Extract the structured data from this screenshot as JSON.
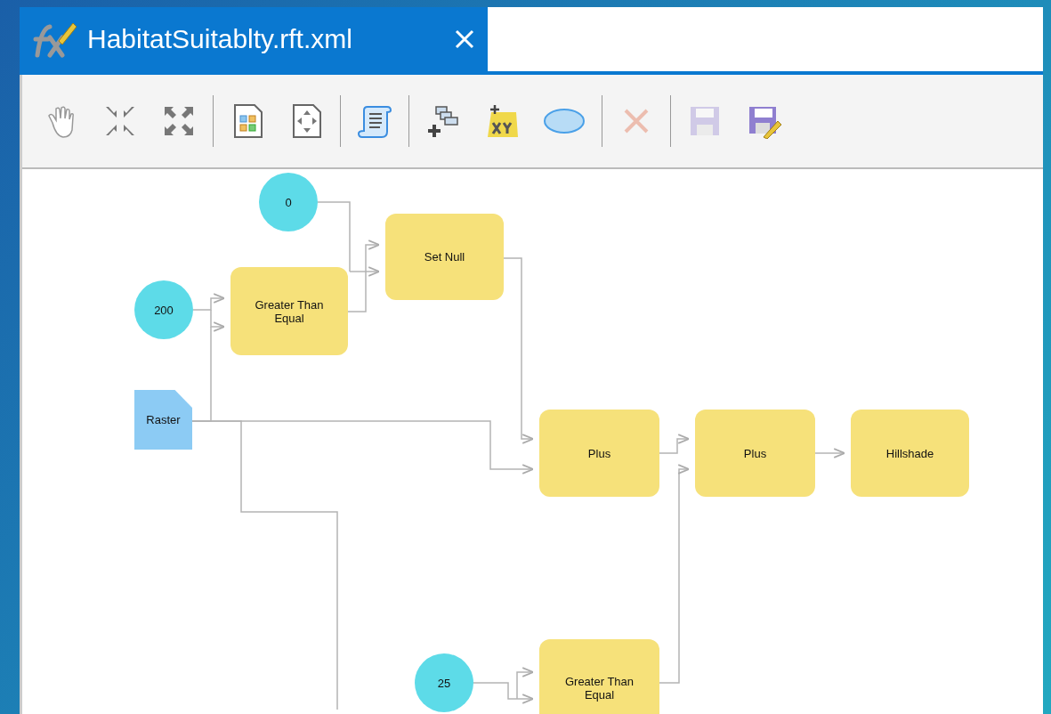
{
  "tab": {
    "title": "HabitatSuitablty.rft.xml",
    "selected": true
  },
  "toolbar_groups": [
    [
      {
        "kind": "pan",
        "disabled": false
      },
      {
        "kind": "collapse",
        "disabled": false
      },
      {
        "kind": "expand",
        "disabled": false
      }
    ],
    [
      {
        "kind": "auto-layout",
        "disabled": false
      },
      {
        "kind": "fit",
        "disabled": false
      }
    ],
    [
      {
        "kind": "script",
        "disabled": false
      }
    ],
    [
      {
        "kind": "add-function",
        "disabled": false
      },
      {
        "kind": "add-xy",
        "disabled": false
      },
      {
        "kind": "ellipse",
        "disabled": false
      }
    ],
    [
      {
        "kind": "delete",
        "disabled": true
      }
    ],
    [
      {
        "kind": "save",
        "disabled": true
      },
      {
        "kind": "save-as",
        "disabled": false
      }
    ]
  ],
  "nodes": [
    {
      "kind": "constant",
      "label": "0"
    },
    {
      "kind": "constant",
      "label": "200"
    },
    {
      "kind": "function",
      "label": "Greater Than Equal"
    },
    {
      "kind": "function",
      "label": "Set Null"
    },
    {
      "kind": "raster",
      "label": "Raster"
    },
    {
      "kind": "function",
      "label": "Plus"
    },
    {
      "kind": "function",
      "label": "Plus"
    },
    {
      "kind": "function",
      "label": "Hillshade"
    },
    {
      "kind": "constant",
      "label": "25"
    },
    {
      "kind": "function",
      "label": "Greater Than Equal"
    }
  ]
}
